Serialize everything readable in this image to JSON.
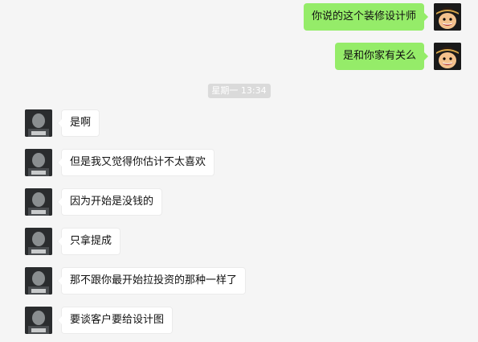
{
  "messages_out": [
    {
      "text": "你说的这个装修设计师"
    },
    {
      "text": "是和你家有关么"
    }
  ],
  "time_separator": "星期一 13:34",
  "messages_in": [
    {
      "text": "是啊"
    },
    {
      "text": "但是我又觉得你估计不太喜欢"
    },
    {
      "text": "因为开始是没钱的"
    },
    {
      "text": "只拿提成"
    },
    {
      "text": "那不跟你最开始拉投资的那种一样了"
    },
    {
      "text": "要谈客户要给设计图"
    }
  ],
  "colors": {
    "background": "#f5f5f5",
    "outgoing_bubble": "#95ec69",
    "incoming_bubble": "#ffffff",
    "time_separator": "#dadada"
  }
}
